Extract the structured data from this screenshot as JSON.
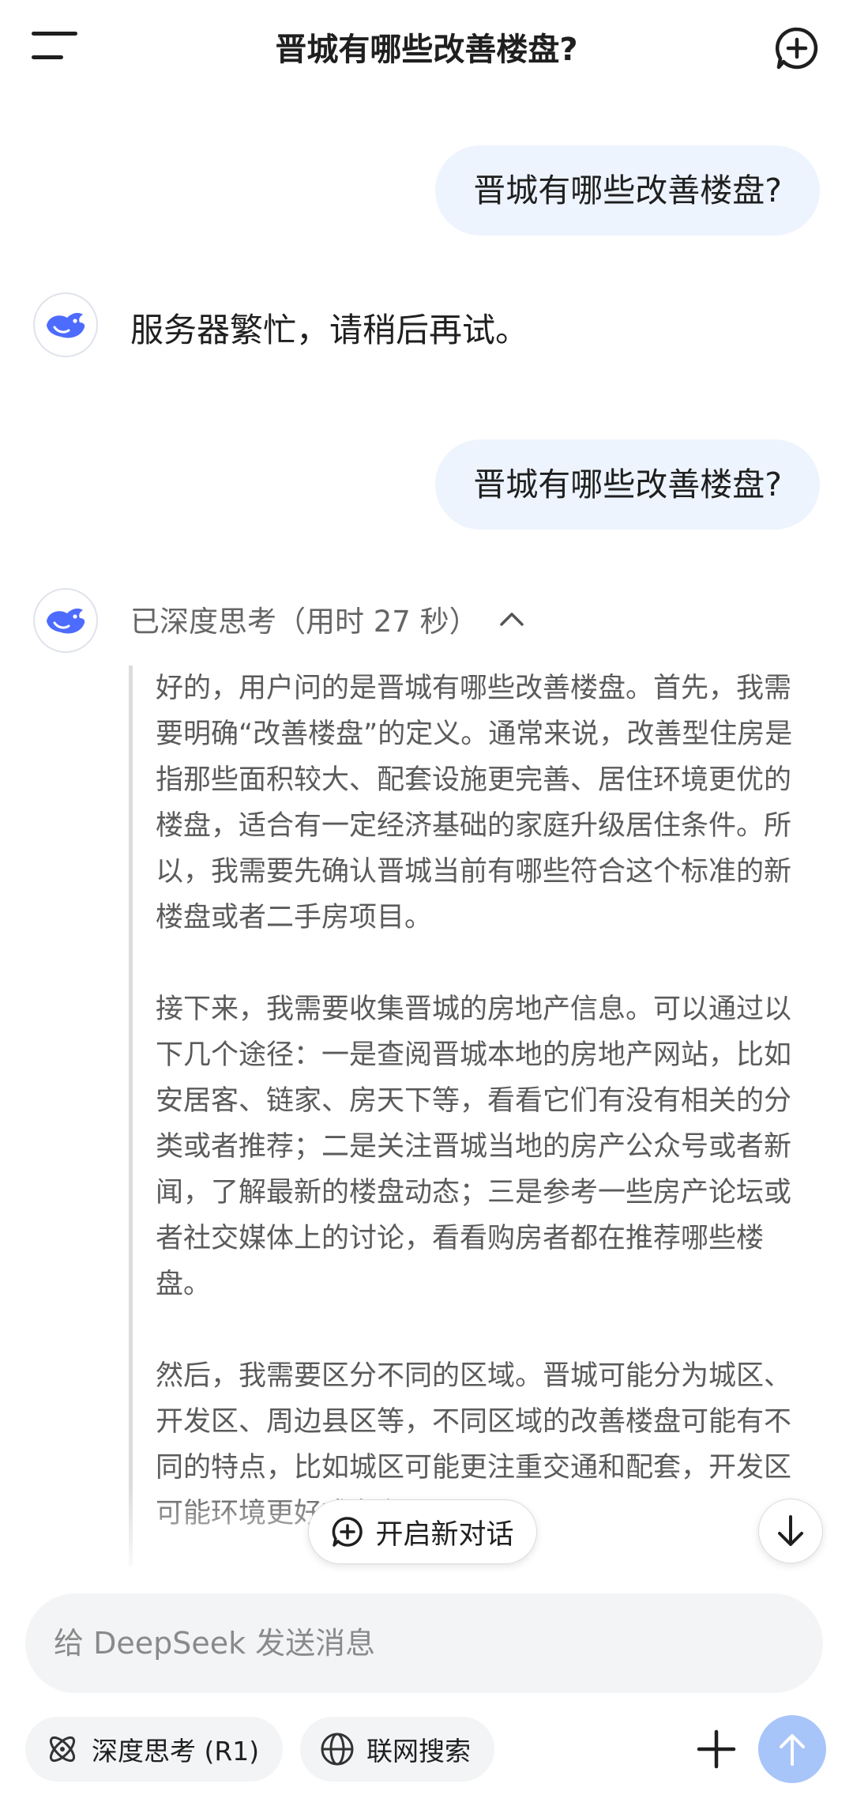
{
  "header": {
    "title": "晋城有哪些改善楼盘?"
  },
  "messages": {
    "user_1": "晋城有哪些改善楼盘?",
    "bot_1": "服务器繁忙，请稍后再试。",
    "user_2": "晋城有哪些改善楼盘?",
    "thinking_header": "已深度思考（用时 27 秒）",
    "thinking_paragraphs": [
      "好的，用户问的是晋城有哪些改善楼盘。首先，我需要明确“改善楼盘”的定义。通常来说，改善型住房是指那些面积较大、配套设施更完善、居住环境更优的楼盘，适合有一定经济基础的家庭升级居住条件。所以，我需要先确认晋城当前有哪些符合这个标准的新楼盘或者二手房项目。",
      "接下来，我需要收集晋城的房地产信息。可以通过以下几个途径：一是查阅晋城本地的房地产网站，比如安居客、链家、房天下等，看看它们有没有相关的分类或者推荐；二是关注晋城当地的房产公众号或者新闻，了解最新的楼盘动态；三是参考一些房产论坛或者社交媒体上的讨论，看看购房者都在推荐哪些楼盘。",
      "然后，我需要区分不同的区域。晋城可能分为城区、开发区、周边县区等，不同区域的改善楼盘可能有不同的特点，比如城区可能更注重交通和配套，开发区可能环境更好或者有更"
    ]
  },
  "floating": {
    "new_dialog_label": "开启新对话"
  },
  "composer": {
    "placeholder": "给 DeepSeek 发送消息",
    "deep_think_label": "深度思考 (R1)",
    "web_search_label": "联网搜索"
  },
  "colors": {
    "accent": "#4d6bfe",
    "user_bubble": "#eef4fe",
    "send_disabled": "#a7c5f9"
  },
  "icons": [
    "menu-icon",
    "new-chat-icon",
    "deepseek-whale-icon",
    "chevron-up-icon",
    "arrow-down-icon",
    "atom-icon",
    "globe-icon",
    "plus-icon",
    "arrow-up-icon"
  ]
}
